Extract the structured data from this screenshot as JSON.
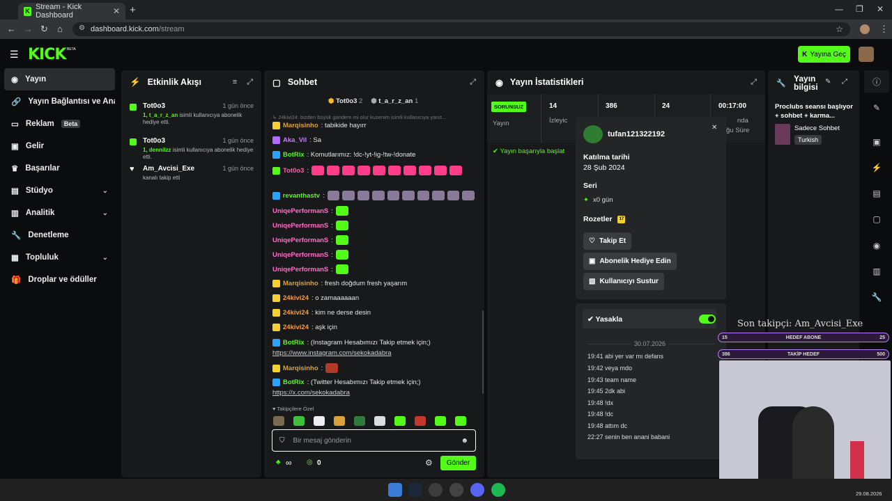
{
  "browser": {
    "tab_title": "Stream - Kick Dashboard",
    "url_host": "dashboard.kick.com",
    "url_path": "/stream"
  },
  "header": {
    "logo": "KICK",
    "logo_sup": "BETA",
    "go_live": "Yayına Geç"
  },
  "sidebar": {
    "items": [
      {
        "label": "Yayın",
        "active": true
      },
      {
        "label": "Yayın Bağlantısı ve Anahtar"
      },
      {
        "label": "Reklam",
        "badge": "Beta"
      },
      {
        "label": "Gelir"
      },
      {
        "label": "Başarılar"
      },
      {
        "label": "Stüdyo",
        "chevron": true
      },
      {
        "label": "Analitik",
        "chevron": true
      },
      {
        "label": "Denetleme"
      },
      {
        "label": "Topluluk",
        "chevron": true
      },
      {
        "label": "Droplar ve ödüller"
      }
    ]
  },
  "activity": {
    "title": "Etkinlik Akışı",
    "events": [
      {
        "name": "Tot0o3",
        "time": "1 gün önce",
        "highlight": "1, t_a_r_z_an",
        "desc": " isimli kullanıcıya abonelik hediye etti."
      },
      {
        "name": "Tot0o3",
        "time": "1 gün önce",
        "highlight": "1, dennilzz",
        "desc": " isimli kullanıcıya abonelik hediye etti."
      },
      {
        "name": "Am_Avcisi_Exe",
        "time": "1 gün önce",
        "highlight": "",
        "desc": "kanalı takip etti"
      }
    ]
  },
  "chat": {
    "title": "Sohbet",
    "pinned": [
      {
        "name": "Tot0o3",
        "count": "2"
      },
      {
        "name": "t_a_r_z_an",
        "count": "1"
      }
    ],
    "reply": "↳ 24kivi24: bizden büyük gündem mi olur kuzenim isimli kullanıcıya yanıt...",
    "messages": [
      {
        "user": "Marqisinho",
        "color": "#d9a23c",
        "text": ": tabikide hayırr"
      },
      {
        "user": "Aka_Vil",
        "color": "#c77dff",
        "text": ": Sa"
      },
      {
        "user": "BotRix",
        "color": "#53fc18",
        "text": ": Komutlarımız: !dc-!yt-!ig-!tw-!donate"
      },
      {
        "user": "Tot0o3",
        "color": "#ff5fa8",
        "text": ":"
      },
      {
        "user": "revanthastv",
        "color": "#53fc18",
        "text": ":"
      },
      {
        "user": "UniqePerformanS",
        "color": "#ff6ec7",
        "text": ":"
      },
      {
        "user": "UniqePerformanS",
        "color": "#ff6ec7",
        "text": ":"
      },
      {
        "user": "UniqePerformanS",
        "color": "#ff6ec7",
        "text": ":"
      },
      {
        "user": "UniqePerformanS",
        "color": "#ff6ec7",
        "text": ":"
      },
      {
        "user": "UniqePerformanS",
        "color": "#ff6ec7",
        "text": ":"
      },
      {
        "user": "Marqisinho",
        "color": "#d9a23c",
        "text": ": fresh doğdum fresh yaşarım"
      },
      {
        "user": "24kivi24",
        "color": "#ff9a3c",
        "text": ": o zamaaaaaan"
      },
      {
        "user": "24kivi24",
        "color": "#ff9a3c",
        "text": ": kim ne derse desin"
      },
      {
        "user": "24kivi24",
        "color": "#ff9a3c",
        "text": ": aşk için"
      },
      {
        "user": "BotRix",
        "color": "#53fc18",
        "text": ": (Instagram Hesabımızı Takip etmek için;)"
      },
      {
        "user": "",
        "color": "",
        "text": "https://www.instagram.com/sekokadabra"
      },
      {
        "user": "Marqisinho",
        "color": "#d9a23c",
        "text": ":"
      },
      {
        "user": "BotRix",
        "color": "#53fc18",
        "text": ": (Twitter Hesabımızı Takip etmek için;)"
      },
      {
        "user": "",
        "color": "",
        "text": "https://x.com/sekokadabra"
      }
    ],
    "followers_only": "Takipçilere Özel",
    "input_placeholder": "Bir mesaj gönderin",
    "points": "∞",
    "coins": "0",
    "send": "Gönder"
  },
  "stats": {
    "title": "Yayın İstatistikleri",
    "status": "SORUNSUZ",
    "status_label": "Yayın",
    "viewers": "14",
    "viewers_label": "İzleyic",
    "followers": "386",
    "subs": "24",
    "duration": "00:17:00",
    "extra_label1": "nda",
    "extra_label2": "ğu Süre",
    "success": "Yayın başarıyla başlat"
  },
  "usercard": {
    "username": "tufan121322192",
    "joined_label": "Katılma tarihi",
    "joined": "28 Şub 2024",
    "streak_label": "Seri",
    "streak": "x0 gün",
    "badges_label": "Rozetler",
    "badge_val": "17",
    "follow": "Takip Et",
    "gift": "Abonelik Hediye Edin",
    "mute": "Kullanıcıyı Sustur",
    "ban": "Yasakla",
    "date": "30.07.2026",
    "history": [
      "19:41 abi yer var mı defans",
      "19:42 veya mdo",
      "19:43 team name",
      "19:45 2dk abi",
      "19:48 !dx",
      "19:48 !dc",
      "19:48 attım dc",
      "22:27 senin ben anani babani"
    ]
  },
  "info": {
    "title": "Yayın bilgisi",
    "stream_title": "Proclubs seansı başlıyor + sohbet + karma...",
    "category": "Sadece Sohbet",
    "language": "Turkish"
  },
  "overlay": {
    "last_follower": "Son takipçi: Am_Avcisi_Exe",
    "bar1_left": "15",
    "bar1_label": "HEDEF ABONE",
    "bar1_right": "25",
    "bar2_left": "386",
    "bar2_label": "TAKİP HEDEF",
    "bar2_right": "500"
  },
  "taskbar": {
    "date": "29.08.2026"
  }
}
